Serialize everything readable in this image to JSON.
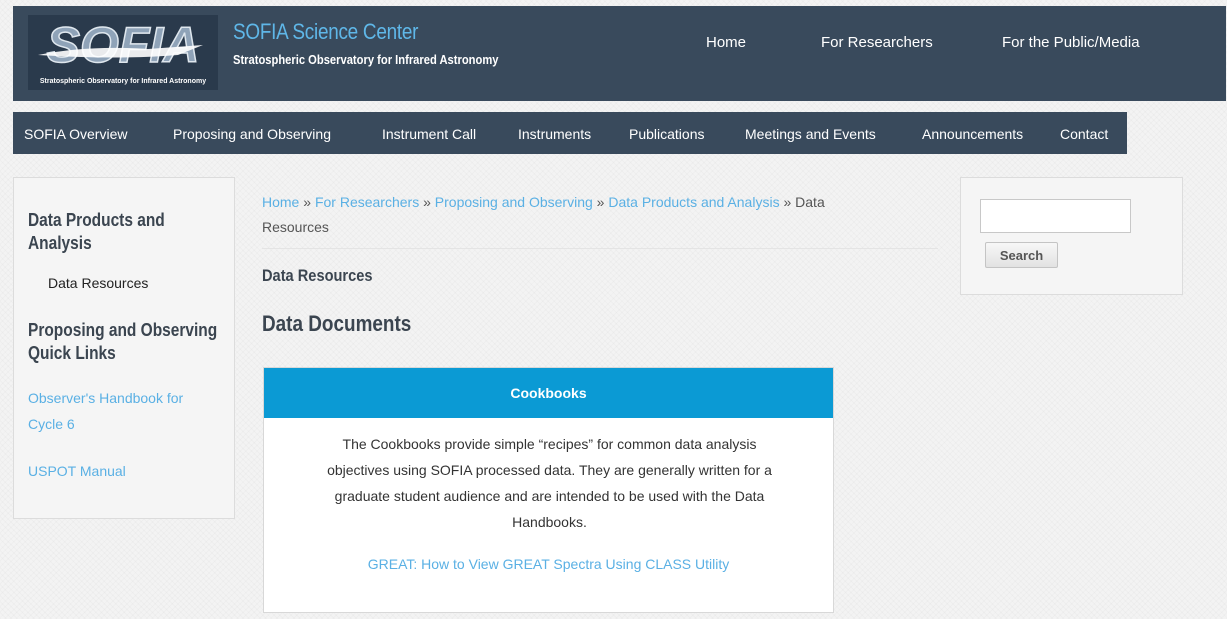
{
  "header": {
    "logo_text": "SOFIA",
    "logo_subtext": "Stratospheric Observatory for Infrared Astronomy",
    "site_title": "SOFIA Science Center",
    "site_slogan": "Stratospheric Observatory for Infrared Astronomy",
    "top_nav": [
      "Home",
      "For Researchers",
      "For the Public/Media"
    ]
  },
  "main_nav": [
    "SOFIA Overview",
    "Proposing and Observing",
    "Instrument Call",
    "Instruments",
    "Publications",
    "Meetings and Events",
    "Announcements",
    "Contact"
  ],
  "left_sidebar": {
    "heading1_line1": "Data Products and",
    "heading1_line2": "Analysis",
    "active_item": "Data Resources",
    "heading2_line1": "Proposing and Observing",
    "heading2_line2": "Quick Links",
    "links": [
      "Observer's Handbook for",
      "Cycle 6",
      "USPOT Manual"
    ]
  },
  "breadcrumb": {
    "items": [
      "Home",
      "For Researchers",
      "Proposing and Observing",
      "Data Products and Analysis"
    ],
    "separator": "»",
    "current_line1": "Data",
    "current_line2": "Resources"
  },
  "content": {
    "page_title": "Data Resources",
    "section_title": "Data Documents",
    "card": {
      "title": "Cookbooks",
      "body_lines": [
        "The Cookbooks provide simple “recipes” for common data analysis",
        "objectives using SOFIA processed data. They are generally written for a",
        "graduate student audience and are intended to be used with the Data",
        "Handbooks."
      ],
      "link": "GREAT: How to View GREAT Spectra Using CLASS Utility"
    }
  },
  "search": {
    "value": "",
    "button_label": "Search"
  },
  "colors": {
    "header_bg": "#394a5c",
    "accent_blue": "#0b9ad4",
    "link_blue": "#5ab0e4",
    "title_blue": "#5fb7e8"
  }
}
